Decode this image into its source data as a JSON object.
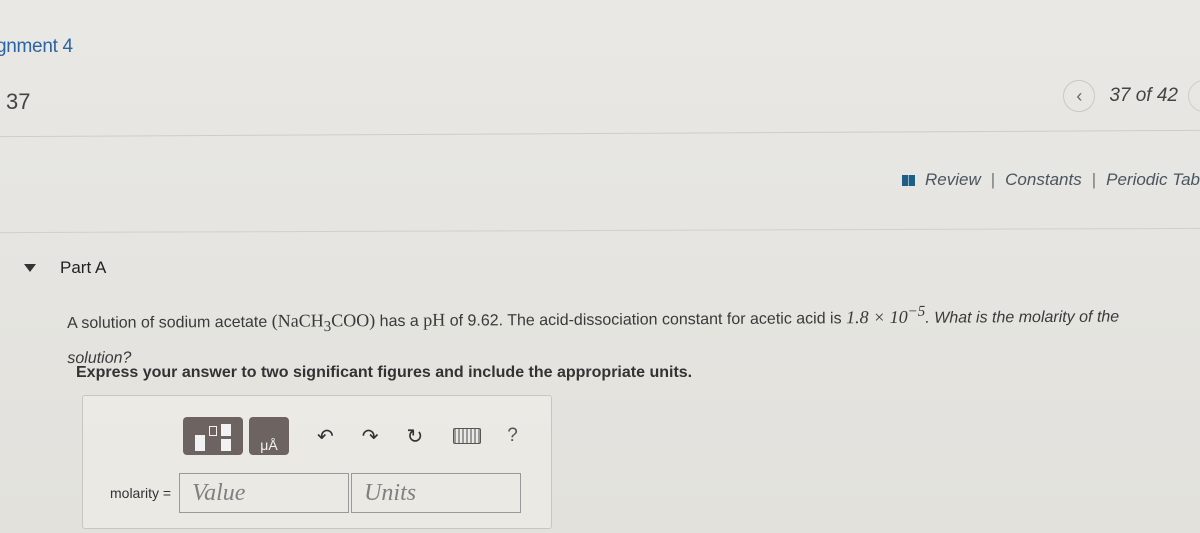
{
  "header": {
    "assignment_title": "gnment 4",
    "question_number": "37",
    "navigation": {
      "prev_icon": "chevron-left",
      "counter": "37 of 42"
    }
  },
  "resources": {
    "icon": "book-icon",
    "links": [
      "Review",
      "Constants",
      "Periodic Tab"
    ],
    "separator": "|"
  },
  "part": {
    "title": "Part A",
    "expanded": true
  },
  "question": {
    "t1": "A solution of sodium acetate ",
    "formula": "(NaCH",
    "formula_sub": "3",
    "formula_end": "COO)",
    "t2": " has a ",
    "ph": "pH",
    "t3": " of 9.62. The acid-dissociation constant for acetic acid is ",
    "ka_base": "1.8 × 10",
    "ka_exp": "−5",
    "t4": ". What is the molarity of the solution?"
  },
  "instruction": "Express your answer to two significant figures and include the appropriate units.",
  "toolbar": {
    "templates_icon": "templates-icon",
    "units_label": "μÅ",
    "undo": "↶",
    "redo": "↷",
    "reset": "↻",
    "keyboard_icon": "keyboard-icon",
    "help": "?"
  },
  "answer": {
    "label": "molarity =",
    "value_placeholder": "Value",
    "units_placeholder": "Units",
    "value": "",
    "units": ""
  },
  "colors": {
    "link_blue": "#2b63a3",
    "book_blue": "#1f5f86",
    "tool_bg": "#6d6461"
  }
}
